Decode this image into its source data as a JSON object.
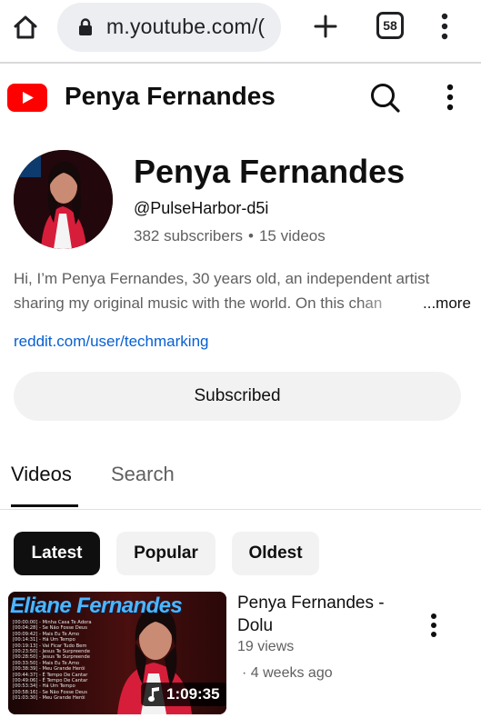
{
  "browser": {
    "url": "m.youtube.com/(",
    "tab_count": "58"
  },
  "header": {
    "title": "Penya Fernandes"
  },
  "channel": {
    "name": "Penya Fernandes",
    "handle": "@PulseHarbor-d5i",
    "subscribers": "382 subscribers",
    "separator": "•",
    "videos": "15 videos",
    "description_line1": "Hi, I’m Penya Fernandes, 30 years old, an independent artist",
    "description_line2": "sharing my original music with the world. On this chan",
    "more_label": "...more",
    "link": "reddit.com/user/techmarking",
    "subscribe_label": "Subscribed"
  },
  "tabs": [
    {
      "label": "Videos",
      "active": true
    },
    {
      "label": "Search",
      "active": false
    }
  ],
  "chips": [
    {
      "label": "Latest",
      "selected": true
    },
    {
      "label": "Popular",
      "selected": false
    },
    {
      "label": "Oldest",
      "selected": false
    }
  ],
  "videos": [
    {
      "title": "Penya Fernandes - Dolu",
      "views": "19 views",
      "age": "· 4 weeks ago",
      "duration": "1:09:35",
      "thumbnail_title": "Eliane Fernandes",
      "tracklist": [
        "[00:00:00] - Minha Casa Te Adora",
        "[00:04:28] - Se Não Fosse Deus",
        "[00:09:42] - Mais Eu Te Amo",
        "[00:14:31] - Há Um Tempo",
        "[00:19:13] - Vai Ficar Tudo Bem",
        "[00:23:50] - Jesus Te Surpreende",
        "[00:28:50] - Jesus Te Surpreende",
        "[00:33:50] - Mais Eu Te Amo",
        "[00:38:39] - Meu Grande Herói",
        "[00:44:37] - É Tempo De Cantar",
        "[00:49:06] - É Tempo De Cantar",
        "[00:53:34] - Há Um Tempo",
        "[00:58:16] - Se Não Fosse Deus",
        "[01:03:30] - Meu Grande Herói"
      ]
    }
  ],
  "colors": {
    "brand_red": "#ff0000",
    "link_blue": "#065fd4",
    "secondary_text": "#606060",
    "chip_bg": "#f2f2f2"
  },
  "icons": [
    "home-icon",
    "lock-icon",
    "plus-icon",
    "tab-switcher-icon",
    "more-vert-icon",
    "youtube-logo-icon",
    "search-icon",
    "music-note-icon"
  ]
}
